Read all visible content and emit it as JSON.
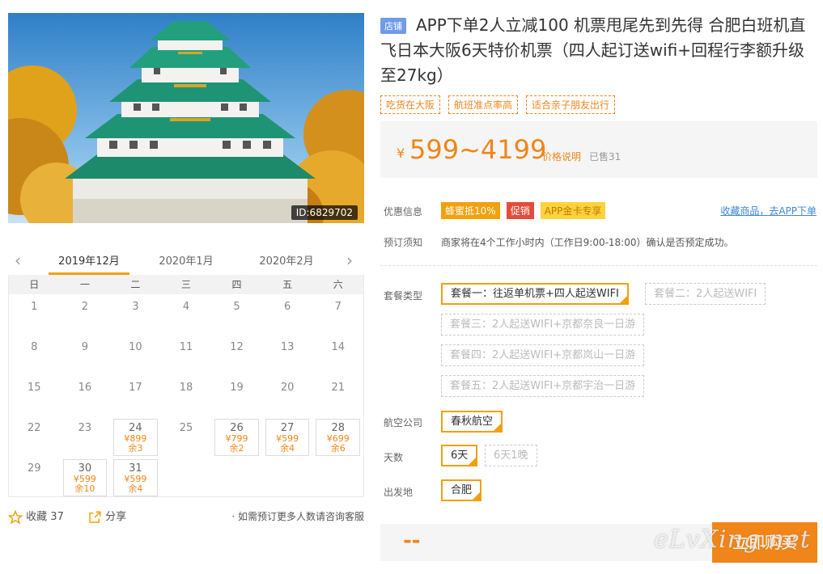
{
  "image": {
    "id_label": "ID:6829702"
  },
  "calendar": {
    "prev_icon": "chevron-left-icon",
    "next_icon": "chevron-right-icon",
    "months": [
      "2019年12月",
      "2020年1月",
      "2020年2月"
    ],
    "active_month": 0,
    "weekdays": [
      "日",
      "一",
      "二",
      "三",
      "四",
      "五",
      "六"
    ],
    "days": [
      {
        "d": "1"
      },
      {
        "d": "2"
      },
      {
        "d": "3"
      },
      {
        "d": "4"
      },
      {
        "d": "5"
      },
      {
        "d": "6"
      },
      {
        "d": "7"
      },
      {
        "d": "8"
      },
      {
        "d": "9"
      },
      {
        "d": "10"
      },
      {
        "d": "11"
      },
      {
        "d": "12"
      },
      {
        "d": "13"
      },
      {
        "d": "14"
      },
      {
        "d": "15"
      },
      {
        "d": "16"
      },
      {
        "d": "17"
      },
      {
        "d": "18"
      },
      {
        "d": "19"
      },
      {
        "d": "20"
      },
      {
        "d": "21"
      },
      {
        "d": "22"
      },
      {
        "d": "23"
      },
      {
        "d": "24",
        "price": "¥899",
        "stock": "余3"
      },
      {
        "d": "25"
      },
      {
        "d": "26",
        "price": "¥799",
        "stock": "余2"
      },
      {
        "d": "27",
        "price": "¥599",
        "stock": "余4"
      },
      {
        "d": "28",
        "price": "¥699",
        "stock": "余6"
      },
      {
        "d": "29"
      },
      {
        "d": "30",
        "price": "¥599",
        "stock": "余10"
      },
      {
        "d": "31",
        "price": "¥599",
        "stock": "余4"
      }
    ]
  },
  "footer_left": {
    "favorite_label": "收藏",
    "favorite_count": "37",
    "share_label": "分享",
    "consult_text": "· 如需预订更多人数请咨询客服"
  },
  "product": {
    "shop_tag": "店铺",
    "title": "APP下单2人立减100 机票甩尾先到先得 合肥白班机直飞日本大阪6天特价机票（四人起订送wifi+回程行李额升级至27kg）",
    "tags": [
      "吃货在大阪",
      "航班准点率高",
      "适合亲子朋友出行"
    ],
    "price": {
      "currency": "¥",
      "range": "599~4199",
      "explain": "价格说明",
      "sold": "已售31"
    },
    "promo_label": "优惠信息",
    "promo_badges": [
      "蜂蜜抵10%",
      "促销",
      "APP金卡专享"
    ],
    "app_link": "收藏商品，去APP下单",
    "notice_label": "预订须知",
    "notice_text": "商家将在4个工作小时内（工作日9:00-18:00）确认是否预定成功。",
    "package_label": "套餐类型",
    "packages": [
      "套餐一：往返单机票+四人起送WIFI",
      "套餐二：2人起送WIFI",
      "套餐三：2人起送WIFI+京都奈良一日游",
      "套餐四：2人起送WIFI+京都岚山一日游",
      "套餐五：2人起送WIFI+京都宇治一日游"
    ],
    "airline_label": "航空公司",
    "airlines": [
      "春秋航空"
    ],
    "days_label": "天数",
    "day_options": [
      "6天",
      "6天1晚"
    ],
    "origin_label": "出发地",
    "origins": [
      "合肥"
    ],
    "total": "--",
    "buy_label": "立即购买",
    "watermark": "eLvXing.net"
  },
  "colors": {
    "accent": "#f08519",
    "selected_border": "#f0a10c",
    "link": "#3f86d6",
    "shop_tag": "#6f9be8"
  }
}
